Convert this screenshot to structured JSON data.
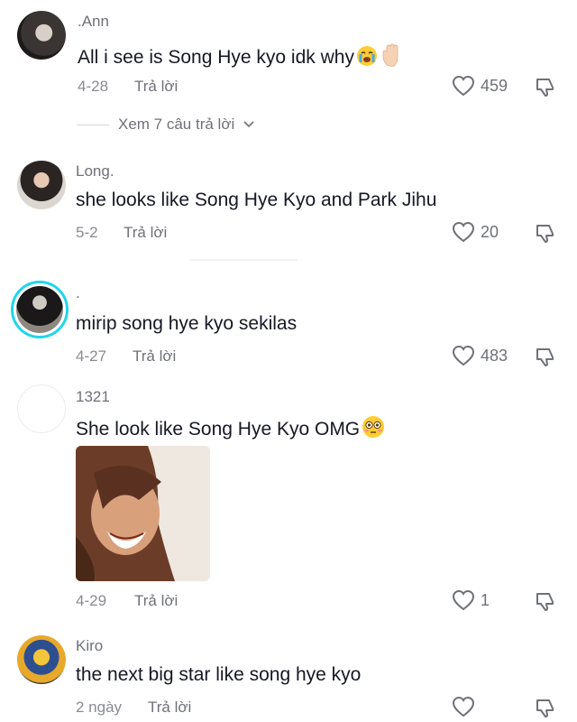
{
  "comments": [
    {
      "username": ".Ann",
      "text": "All i see is Song Hye kyo idk why",
      "emojis": [
        "loudly-crying-face",
        "raised-hand"
      ],
      "date": "4-28",
      "reply_label": "Trả lời",
      "likes": "459"
    },
    {
      "username": "Long.",
      "text": "she looks like Song Hye Kyo and Park Jihu",
      "date": "5-2",
      "reply_label": "Trả lời",
      "likes": "20"
    },
    {
      "username": ".",
      "text": "mirip song hye kyo sekilas",
      "date": "4-27",
      "reply_label": "Trả lời",
      "likes": "483"
    },
    {
      "username": "1321",
      "text": "She look like Song Hye Kyo OMG",
      "emojis": [
        "flushed-face"
      ],
      "date": "4-29",
      "reply_label": "Trả lời",
      "likes": "1"
    },
    {
      "username": "Kiro",
      "text": "the next big star like song hye kyo",
      "date": "2 ngày",
      "reply_label": "Trả lời",
      "likes": ""
    }
  ],
  "view_replies": "Xem 7 câu trả lời",
  "colors": {
    "story_ring": "#20d5ec",
    "text_primary": "#161823",
    "text_secondary": "#6f7178"
  }
}
